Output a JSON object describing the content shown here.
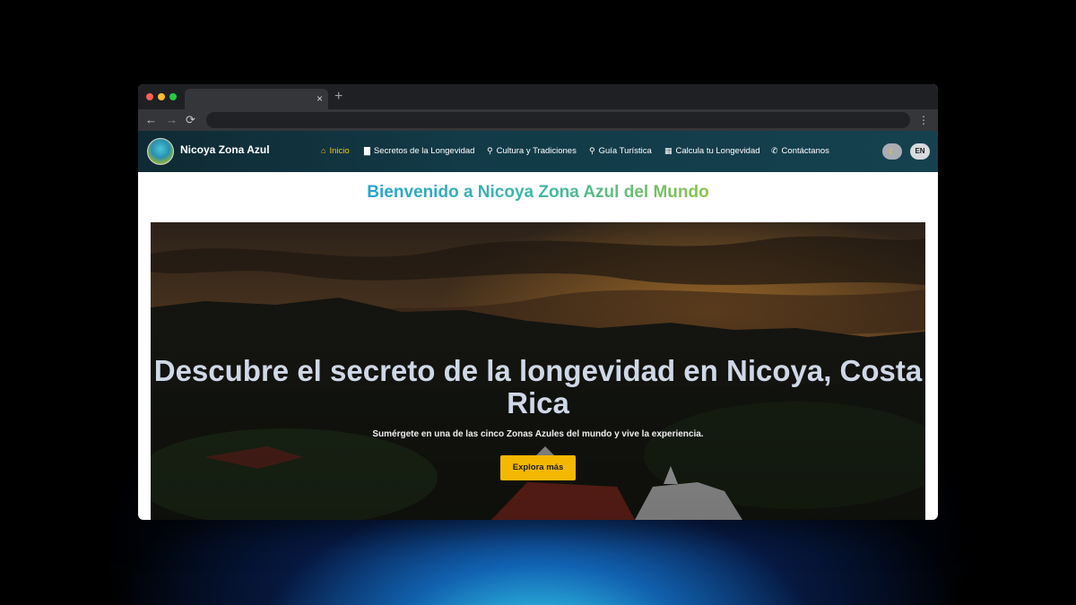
{
  "browser": {
    "tab_close": "×",
    "new_tab": "+",
    "back": "←",
    "forward": "→",
    "reload": "⟳",
    "menu": "⋮"
  },
  "site": {
    "brand": "Nicoya Zona Azul",
    "nav": [
      {
        "label": "Inicio",
        "icon": "home-icon",
        "glyph": "⌂"
      },
      {
        "label": "Secretos de la Longevidad",
        "icon": "book-icon",
        "glyph": "▇"
      },
      {
        "label": "Cultura y Tradiciones",
        "icon": "map-marker-icon",
        "glyph": "⚲"
      },
      {
        "label": "Guía Turística",
        "icon": "map-marker-icon",
        "glyph": "⚲"
      },
      {
        "label": "Calcula tu Longevidad",
        "icon": "calculator-icon",
        "glyph": "▦"
      },
      {
        "label": "Contáctanos",
        "icon": "phone-icon",
        "glyph": "✆"
      }
    ],
    "theme_toggle": "☾",
    "lang_button": "EN",
    "accent_color": "#f5c518"
  },
  "page": {
    "title": "Bienvenido a Nicoya Zona Azul del Mundo",
    "hero": {
      "title": "Descubre el secreto de la longevidad en Nicoya, Costa Rica",
      "subtitle": "Sumérgete en una de las cinco Zonas Azules del mundo y vive la experiencia.",
      "button": "Explora más",
      "button_color": "#f5b800"
    }
  }
}
